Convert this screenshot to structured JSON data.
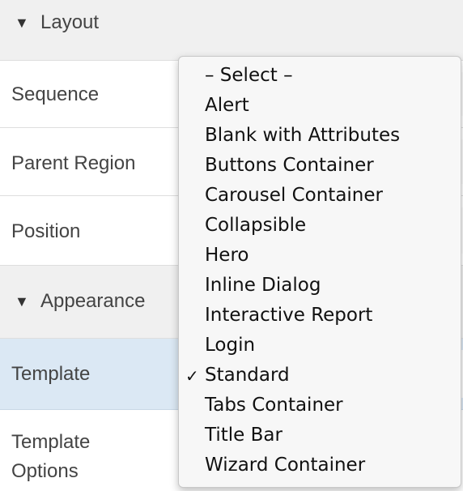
{
  "layout_group": {
    "caret": "▼",
    "label": "Layout"
  },
  "appearance_group": {
    "caret": "▼",
    "label": "Appearance"
  },
  "properties": {
    "sequence": "Sequence",
    "parent_region": "Parent Region",
    "position": "Position",
    "template": "Template",
    "template_options_line1": "Template",
    "template_options_line2": "Options"
  },
  "dropdown": {
    "selected_mark": "✓",
    "options": [
      "– Select –",
      "Alert",
      "Blank with Attributes",
      "Buttons Container",
      "Carousel Container",
      "Collapsible",
      "Hero",
      "Inline Dialog",
      "Interactive Report",
      "Login",
      "Standard",
      "Tabs Container",
      "Title Bar",
      "Wizard Container"
    ],
    "selected_value": "Standard"
  }
}
